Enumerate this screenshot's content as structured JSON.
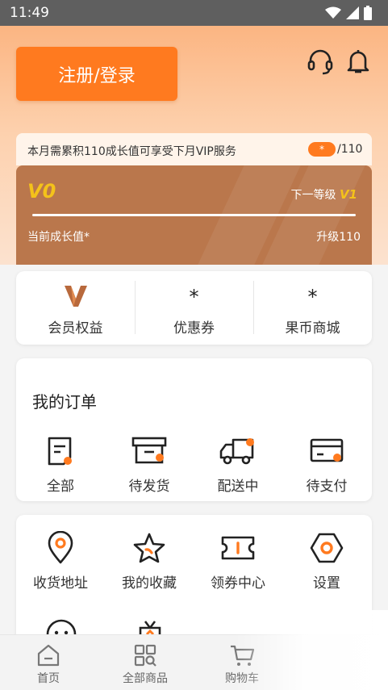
{
  "status_bar": {
    "time": "11:49"
  },
  "header": {
    "login_label": "注册/登录",
    "icons": [
      "headset-icon",
      "bell-icon"
    ]
  },
  "vip": {
    "notice": "本月需累积110成长值可享受下月VIP服务",
    "pill": "*",
    "total": "/110",
    "level": "V0",
    "next_level_label": "下一等级",
    "next_level": "V1",
    "current_label": "当前成长值*",
    "upgrade_label": "升级110",
    "progress": 0,
    "accent": "#ba774c"
  },
  "benefits": [
    {
      "label": "会员权益",
      "icon": "v-logo-icon"
    },
    {
      "label": "优惠券",
      "icon": "*"
    },
    {
      "label": "果币商城",
      "icon": "*"
    }
  ],
  "orders": {
    "title": "我的订单",
    "items": [
      {
        "label": "全部",
        "icon": "document-icon"
      },
      {
        "label": "待发货",
        "icon": "box-icon"
      },
      {
        "label": "配送中",
        "icon": "truck-icon"
      },
      {
        "label": "待支付",
        "icon": "card-icon"
      }
    ]
  },
  "tools": [
    {
      "label": "收货地址",
      "icon": "location-icon"
    },
    {
      "label": "我的收藏",
      "icon": "star-icon"
    },
    {
      "label": "领券中心",
      "icon": "ticket-icon"
    },
    {
      "label": "设置",
      "icon": "settings-icon"
    }
  ],
  "tabbar": [
    {
      "label": "首页",
      "icon": "home-icon"
    },
    {
      "label": "全部商品",
      "icon": "grid-icon"
    },
    {
      "label": "购物车",
      "icon": "cart-icon"
    }
  ],
  "colors": {
    "brand": "#ff7a1f",
    "dark_icon": "#333333"
  }
}
